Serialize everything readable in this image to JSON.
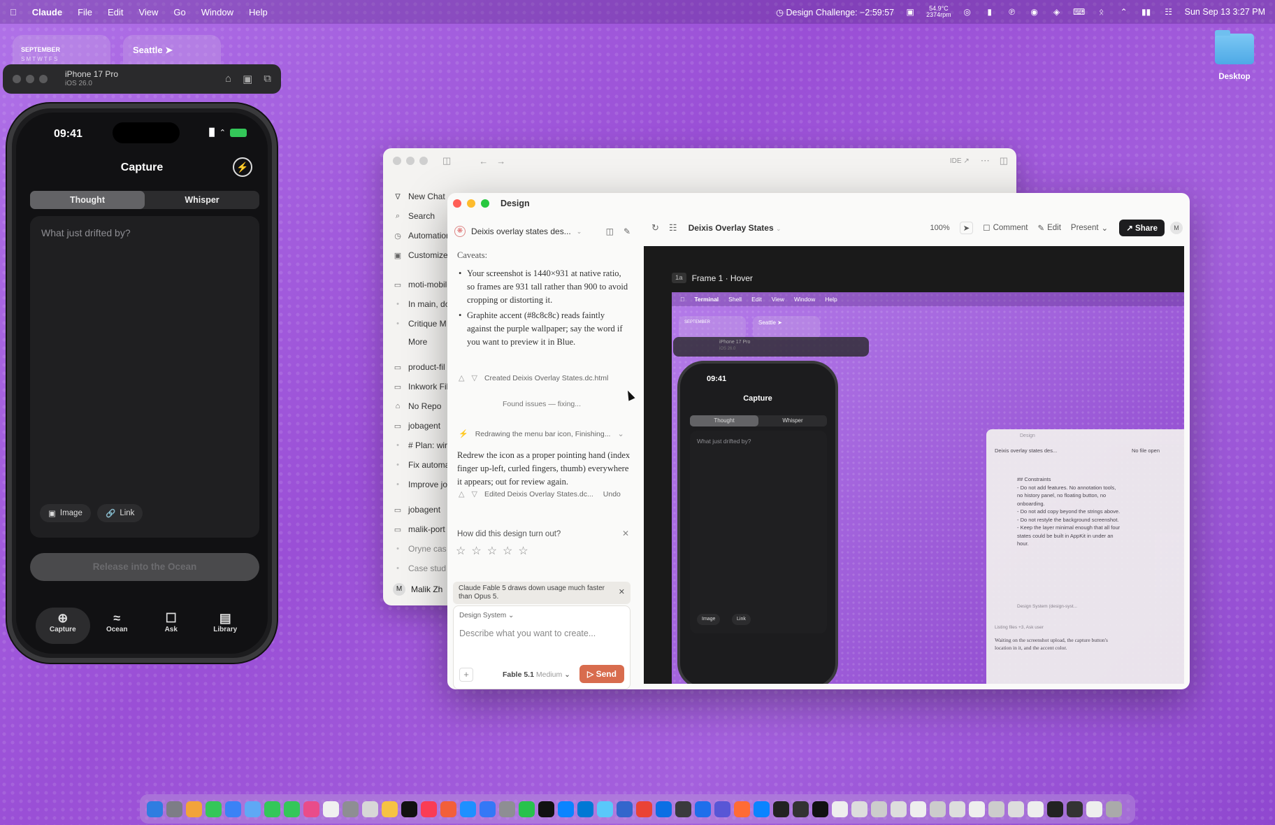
{
  "menubar": {
    "app_name": "Claude",
    "menus": [
      "File",
      "Edit",
      "View",
      "Go",
      "Window",
      "Help"
    ],
    "timer": "Design Challenge: −2:59:57",
    "temp_top": "54.9°C",
    "temp_bottom": "2374rpm",
    "datetime": "Sun Sep 13  3:27 PM"
  },
  "widgets": {
    "calendar_month": "SEPTEMBER",
    "calendar_days": "S M T W T F S",
    "weather_city": "Seattle ➤"
  },
  "desktop": {
    "folder_label": "Desktop"
  },
  "simulator": {
    "device_name": "iPhone 17 Pro",
    "os_version": "iOS 26.0"
  },
  "phone": {
    "time": "09:41",
    "title": "Capture",
    "segments": [
      "Thought",
      "Whisper"
    ],
    "placeholder": "What just drifted by?",
    "chip_image": "Image",
    "chip_link": "Link",
    "release_button": "Release into the Ocean",
    "tabs": [
      "Capture",
      "Ocean",
      "Ask",
      "Library"
    ]
  },
  "back_window": {
    "toolbar_right": "IDE ↗",
    "sidebar": [
      {
        "label": "New Chat",
        "icon": "new-chat-icon"
      },
      {
        "label": "Search",
        "icon": "search-icon"
      },
      {
        "label": "Automations",
        "icon": "clock-icon"
      },
      {
        "label": "Customize",
        "icon": "customize-icon"
      },
      {
        "label": "moti-mobile",
        "icon": "folder-icon"
      },
      {
        "label": "In main, do",
        "icon": "dot-icon"
      },
      {
        "label": "Critique M",
        "icon": "dot-icon"
      },
      {
        "label": "More",
        "icon": ""
      },
      {
        "label": "product-fil",
        "icon": "folder-icon"
      },
      {
        "label": "Inkwork Fil",
        "icon": "folder-icon"
      },
      {
        "label": "No Repo",
        "icon": "home-icon"
      },
      {
        "label": "jobagent",
        "icon": "folder-icon"
      },
      {
        "label": "# Plan: wir",
        "icon": "dot-icon"
      },
      {
        "label": "Fix automa",
        "icon": "dot-icon"
      },
      {
        "label": "Improve jo",
        "icon": "dot-icon"
      },
      {
        "label": "jobagent",
        "icon": "folder-icon"
      },
      {
        "label": "malik-port",
        "icon": "folder-icon"
      },
      {
        "label": "Oryne cas",
        "icon": "dot-icon"
      },
      {
        "label": "Case stud",
        "icon": "dot-icon"
      }
    ],
    "user_initial": "M",
    "user_name": "Malik Zh"
  },
  "design_window": {
    "title": "Design",
    "chat": {
      "project_name": "Deixis overlay states des...",
      "caveats_label": "Caveats:",
      "bullets": [
        "Your screenshot is 1440×931 at native ratio, so frames are 931 tall rather than 900 to avoid cropping or distorting it.",
        "Graphite accent (#8c8c8c) reads faintly against the purple wallpaper; say the word if you want to preview it in Blue."
      ],
      "created_file": "Created Deixis Overlay States.dc.html",
      "status_fixing": "Found issues — fixing...",
      "task_line": "Redrawing the menu bar icon, Finishing...",
      "redrew_text": "Redrew the icon as a proper pointing hand (index finger up-left, curled fingers, thumb) everywhere it appears; out for review again.",
      "edited_file": "Edited Deixis Overlay States.dc...",
      "undo_label": "Undo",
      "rating_question": "How did this design turn out?",
      "rating_stars": 0,
      "notice": "Claude Fable 5 draws down usage much faster than Opus 5.",
      "design_system_label": "Design System",
      "composer_placeholder": "Describe what you want to create...",
      "model_name": "Fable 5.1",
      "model_effort": "Medium",
      "send_label": "Send"
    },
    "canvas_header": {
      "file_title": "Deixis Overlay States",
      "zoom": "100%",
      "comment_label": "Comment",
      "edit_label": "Edit",
      "present_label": "Present",
      "share_label": "Share",
      "avatar": "M"
    },
    "frame": {
      "tag": "1a",
      "label": "Frame 1 · Hover",
      "menubar_items": [
        "Terminal",
        "Shell",
        "Edit",
        "View",
        "Window",
        "Help"
      ],
      "widget_month": "SEPTEMBER",
      "widget_city": "Seattle ➤",
      "sim_device": "iPhone 17 Pro",
      "sim_os": "iOS 26.0",
      "phone_time": "09:41",
      "phone_title": "Capture",
      "segments": [
        "Thought",
        "Whisper"
      ],
      "placeholder": "What just drifted by?",
      "chip_image": "Image",
      "chip_link": "Link",
      "mini_window_title": "Design",
      "mini_project": "Deixis overlay states des...",
      "mini_no_file": "No file open",
      "mini_text": "## Constraints\n- Do not add features. No annotation tools, no history panel, no floating button, no onboarding.\n- Do not add copy beyond the strings above.\n- Do not restyle the background screenshot.\n- Keep the layer minimal enough that all four states could be built in AppKit in under an hour.",
      "mini_chip": "Design System (design-syst...",
      "mini_tool_line": "Listing files +3, Ask user",
      "mini_wait": "Waiting on the screenshot upload, the capture button's location in it, and the accent color."
    }
  },
  "colors": {
    "close": "#ff5f57",
    "minimize": "#febc2e",
    "zoom": "#28c840",
    "send": "#d86c4e",
    "wallpaper": "#a55ee0"
  },
  "dock_colors": [
    "#2f7de1",
    "#7d7d86",
    "#f2a33a",
    "#34c759",
    "#3b82f6",
    "#5fa8f5",
    "#34c759",
    "#34c759",
    "#e94c8a",
    "#f0f0f0",
    "#8e8e93",
    "#d7d7d7",
    "#f6c343",
    "#111111",
    "#fa3c55",
    "#f25f3a",
    "#1e90ff",
    "#3478f6",
    "#8e8e93",
    "#27c24c",
    "#111111",
    "#0a84ff",
    "#0078d4",
    "#5ac8fa",
    "#3366cc",
    "#ea4335",
    "#0b6fe4",
    "#3a3a3c",
    "#1f6feb",
    "#5856d6",
    "#ff6b35",
    "#0a84ff",
    "#222",
    "#333",
    "#111",
    "#eee",
    "#ddd",
    "#ccc",
    "#ddd",
    "#eee",
    "#ccc",
    "#ddd",
    "#eee",
    "#ccc",
    "#ddd",
    "#eee",
    "#222",
    "#333",
    "#eee",
    "#aaa"
  ]
}
